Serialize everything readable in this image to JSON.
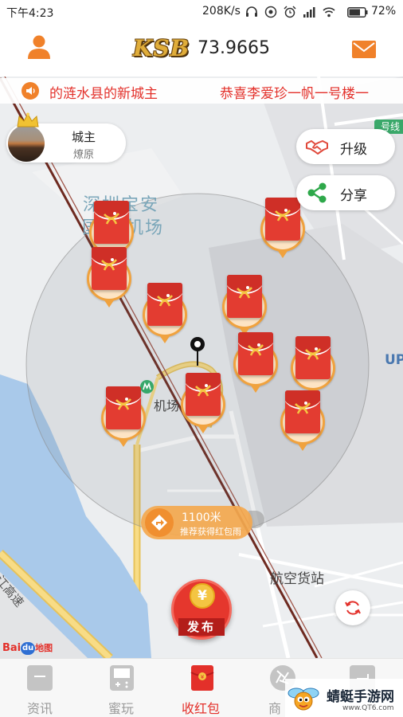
{
  "status_bar": {
    "time": "下午4:23",
    "network_speed": "208K/s",
    "battery": "72%",
    "icons": [
      "headphones-icon",
      "sync-icon",
      "alarm-icon",
      "signal-icon",
      "wifi-icon",
      "battery-icon"
    ]
  },
  "header": {
    "logo": "KSB",
    "balance": "73.9665",
    "left_icon": "user-icon",
    "right_icon": "mail-icon"
  },
  "marquee": {
    "icon": "speaker-icon",
    "messages": [
      "的涟水县的新城主",
      "恭喜李爱珍一帆一号楼一"
    ]
  },
  "city_owner": {
    "title": "城主",
    "name": "燎原"
  },
  "actions": {
    "upgrade": "升级",
    "share": "分享"
  },
  "map": {
    "labels": {
      "area_line1": "深圳宝安",
      "area_line2_a": "国",
      "area_line2_b": "机场",
      "terminal": "机场",
      "up": "UP",
      "cargo": "航空货站",
      "highway": "江高速",
      "metro_line": "号线"
    },
    "baidu_logo": {
      "bai": "Bai",
      "du": "du",
      "ditu": "地图"
    }
  },
  "distance": {
    "value": "1100米",
    "hint": "推荐获得红包雨"
  },
  "publish": {
    "label": "发布",
    "coin": "¥"
  },
  "nav": {
    "active_index": 2,
    "items": [
      {
        "label": "资讯",
        "icon": "news-icon"
      },
      {
        "label": "蜜玩",
        "icon": "game-icon"
      },
      {
        "label": "收红包",
        "icon": "red-envelope-icon"
      },
      {
        "label": "商",
        "icon": "shop-icon"
      },
      {
        "label": "",
        "icon": "profile-icon"
      }
    ]
  },
  "watermark": {
    "name": "蜻蜓手游网",
    "url": "www.QT6.com"
  },
  "colors": {
    "accent": "#f0812a",
    "red": "#e3302a",
    "nav_active": "#e3302a",
    "map_label": "#7aa6b9",
    "water": "#a9c9ea"
  }
}
